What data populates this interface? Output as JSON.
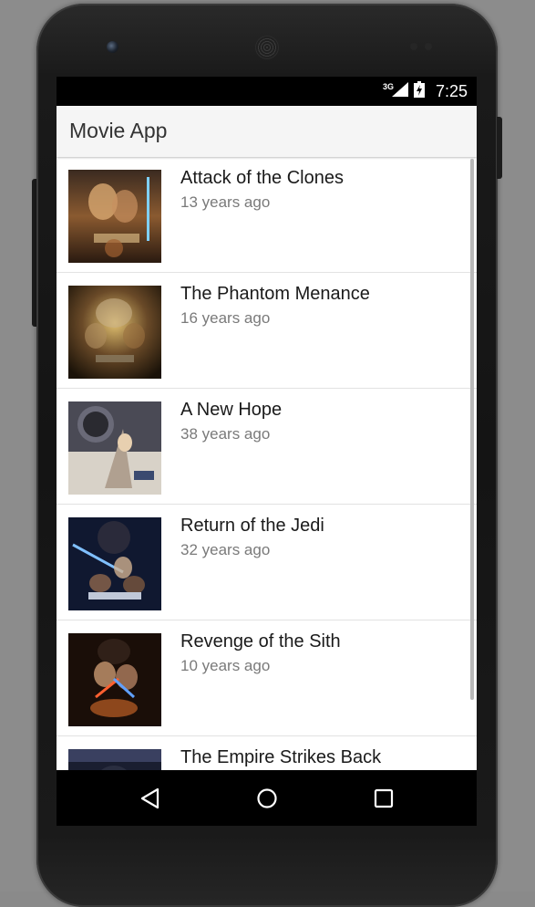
{
  "status_bar": {
    "network_type": "3G",
    "time": "7:25"
  },
  "app_bar": {
    "title": "Movie App"
  },
  "movies": [
    {
      "title": "Attack of the Clones",
      "released": "13 years ago"
    },
    {
      "title": "The Phantom Menance",
      "released": "16 years ago"
    },
    {
      "title": "A New Hope",
      "released": "38 years ago"
    },
    {
      "title": "Return of the Jedi",
      "released": "32 years ago"
    },
    {
      "title": "Revenge of the Sith",
      "released": "10 years ago"
    },
    {
      "title": "The Empire Strikes Back",
      "released": ""
    }
  ],
  "nav_bar": {
    "back_icon": "back-triangle-icon",
    "home_icon": "home-circle-icon",
    "recents_icon": "recents-square-icon"
  },
  "colors": {
    "status_bar": "#000000",
    "app_bar": "#f5f5f5",
    "title_text": "#1a1a1a",
    "subtitle_text": "#7a7a7a",
    "divider": "#e2e2e2"
  }
}
